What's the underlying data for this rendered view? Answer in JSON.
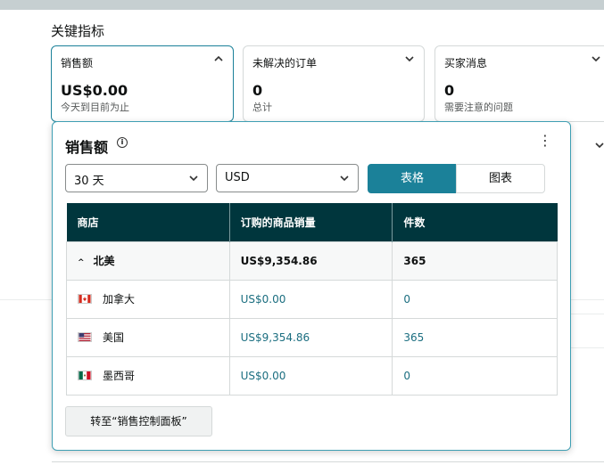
{
  "section_title": "关键指标",
  "cards": [
    {
      "label": "销售额",
      "value": "US$0.00",
      "sub": "今天到目前为止"
    },
    {
      "label": "未解决的订单",
      "value": "0",
      "sub": "总计"
    },
    {
      "label": "买家消息",
      "value": "0",
      "sub": "需要注意的问题"
    }
  ],
  "popup": {
    "title": "销售额",
    "info_icon": "i",
    "more_icon": "⋮",
    "period": "30 天",
    "currency": "USD",
    "view_table": "表格",
    "view_chart": "图表",
    "headers": [
      "商店",
      "订购的商品销量",
      "件数"
    ],
    "region": {
      "name": "北美",
      "sales": "US$9,354.86",
      "units": "365"
    },
    "rows": [
      {
        "flag": "canada-flag",
        "name": "加拿大",
        "sales": "US$0.00",
        "units": "0"
      },
      {
        "flag": "us-flag",
        "name": "美国",
        "sales": "US$9,354.86",
        "units": "365"
      },
      {
        "flag": "mexico-flag",
        "name": "墨西哥",
        "sales": "US$0.00",
        "units": "0"
      }
    ],
    "goto_button": "转至“销售控制面板”"
  },
  "colors": {
    "accent": "#1b8199",
    "header_bg": "#00363d"
  }
}
